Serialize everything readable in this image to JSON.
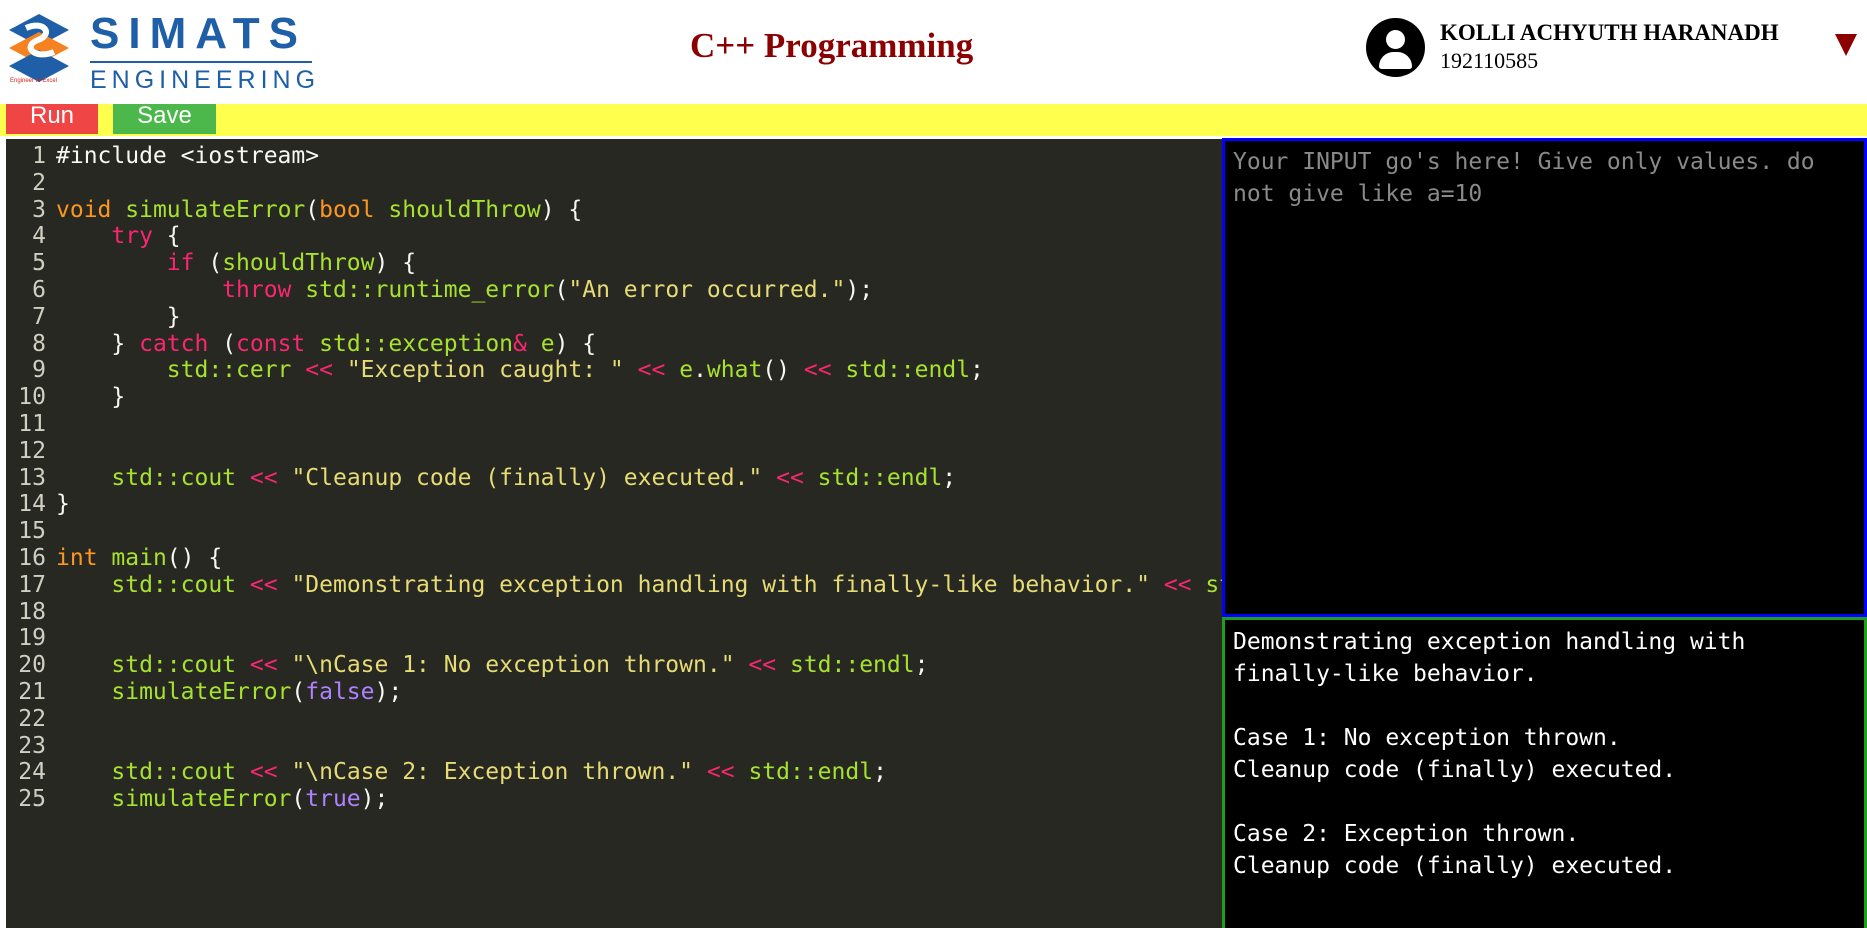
{
  "header": {
    "brand_name": "SIMATS",
    "brand_sub": "ENGINEERING",
    "brand_tagline": "Engineer to Excel",
    "course_title": "C++ Programming",
    "user_name": "KOLLI ACHYUTH HARANADH",
    "user_id": "192110585"
  },
  "toolbar": {
    "run_label": "Run",
    "save_label": "Save"
  },
  "editor": {
    "lines": [
      {
        "n": "1",
        "t": [
          [
            "pp",
            "#include <iostream>"
          ]
        ]
      },
      {
        "n": "2",
        "t": []
      },
      {
        "n": "3",
        "t": [
          [
            "type",
            "void"
          ],
          [
            "p",
            " "
          ],
          [
            "fn",
            "simulateError"
          ],
          [
            "p",
            "("
          ],
          [
            "type",
            "bool"
          ],
          [
            "p",
            " "
          ],
          [
            "id",
            "shouldThrow"
          ],
          [
            "p",
            ") {"
          ]
        ]
      },
      {
        "n": "4",
        "t": [
          [
            "p",
            "    "
          ],
          [
            "kw",
            "try"
          ],
          [
            "p",
            " {"
          ]
        ]
      },
      {
        "n": "5",
        "t": [
          [
            "p",
            "        "
          ],
          [
            "kw",
            "if"
          ],
          [
            "p",
            " ("
          ],
          [
            "id",
            "shouldThrow"
          ],
          [
            "p",
            ") {"
          ]
        ]
      },
      {
        "n": "6",
        "t": [
          [
            "p",
            "            "
          ],
          [
            "kw",
            "throw"
          ],
          [
            "p",
            " "
          ],
          [
            "fn",
            "std::runtime_error"
          ],
          [
            "p",
            "("
          ],
          [
            "str",
            "\"An error occurred.\""
          ],
          [
            "p",
            ");"
          ]
        ]
      },
      {
        "n": "7",
        "t": [
          [
            "p",
            "        }"
          ]
        ]
      },
      {
        "n": "8",
        "t": [
          [
            "p",
            "    } "
          ],
          [
            "kw",
            "catch"
          ],
          [
            "p",
            " ("
          ],
          [
            "kw",
            "const"
          ],
          [
            "p",
            " "
          ],
          [
            "id",
            "std::exception"
          ],
          [
            "op",
            "&"
          ],
          [
            "p",
            " "
          ],
          [
            "id",
            "e"
          ],
          [
            "p",
            ") {"
          ]
        ]
      },
      {
        "n": "9",
        "t": [
          [
            "p",
            "        "
          ],
          [
            "id",
            "std::cerr"
          ],
          [
            "p",
            " "
          ],
          [
            "op",
            "<<"
          ],
          [
            "p",
            " "
          ],
          [
            "str",
            "\"Exception caught: \""
          ],
          [
            "p",
            " "
          ],
          [
            "op",
            "<<"
          ],
          [
            "p",
            " "
          ],
          [
            "id",
            "e"
          ],
          [
            "p",
            "."
          ],
          [
            "fn",
            "what"
          ],
          [
            "p",
            "() "
          ],
          [
            "op",
            "<<"
          ],
          [
            "p",
            " "
          ],
          [
            "id",
            "std::endl"
          ],
          [
            "p",
            ";"
          ]
        ]
      },
      {
        "n": "10",
        "t": [
          [
            "p",
            "    }"
          ]
        ]
      },
      {
        "n": "11",
        "t": []
      },
      {
        "n": "12",
        "t": []
      },
      {
        "n": "13",
        "t": [
          [
            "p",
            "    "
          ],
          [
            "id",
            "std::cout"
          ],
          [
            "p",
            " "
          ],
          [
            "op",
            "<<"
          ],
          [
            "p",
            " "
          ],
          [
            "str",
            "\"Cleanup code (finally) executed.\""
          ],
          [
            "p",
            " "
          ],
          [
            "op",
            "<<"
          ],
          [
            "p",
            " "
          ],
          [
            "id",
            "std::endl"
          ],
          [
            "p",
            ";"
          ]
        ]
      },
      {
        "n": "14",
        "t": [
          [
            "p",
            "}"
          ]
        ]
      },
      {
        "n": "15",
        "t": []
      },
      {
        "n": "16",
        "t": [
          [
            "type",
            "int"
          ],
          [
            "p",
            " "
          ],
          [
            "fn",
            "main"
          ],
          [
            "p",
            "() {"
          ]
        ]
      },
      {
        "n": "17",
        "t": [
          [
            "p",
            "    "
          ],
          [
            "id",
            "std::cout"
          ],
          [
            "p",
            " "
          ],
          [
            "op",
            "<<"
          ],
          [
            "p",
            " "
          ],
          [
            "str",
            "\"Demonstrating exception handling with finally-like behavior.\""
          ],
          [
            "p",
            " "
          ],
          [
            "op",
            "<<"
          ],
          [
            "p",
            " "
          ],
          [
            "id",
            "std::endl"
          ],
          [
            "p",
            ";"
          ]
        ]
      },
      {
        "n": "18",
        "t": []
      },
      {
        "n": "19",
        "t": []
      },
      {
        "n": "20",
        "t": [
          [
            "p",
            "    "
          ],
          [
            "id",
            "std::cout"
          ],
          [
            "p",
            " "
          ],
          [
            "op",
            "<<"
          ],
          [
            "p",
            " "
          ],
          [
            "str",
            "\"\\nCase 1: No exception thrown.\""
          ],
          [
            "p",
            " "
          ],
          [
            "op",
            "<<"
          ],
          [
            "p",
            " "
          ],
          [
            "id",
            "std::endl"
          ],
          [
            "p",
            ";"
          ]
        ]
      },
      {
        "n": "21",
        "t": [
          [
            "p",
            "    "
          ],
          [
            "fn",
            "simulateError"
          ],
          [
            "p",
            "("
          ],
          [
            "const",
            "false"
          ],
          [
            "p",
            ");"
          ]
        ]
      },
      {
        "n": "22",
        "t": []
      },
      {
        "n": "23",
        "t": []
      },
      {
        "n": "24",
        "t": [
          [
            "p",
            "    "
          ],
          [
            "id",
            "std::cout"
          ],
          [
            "p",
            " "
          ],
          [
            "op",
            "<<"
          ],
          [
            "p",
            " "
          ],
          [
            "str",
            "\"\\nCase 2: Exception thrown.\""
          ],
          [
            "p",
            " "
          ],
          [
            "op",
            "<<"
          ],
          [
            "p",
            " "
          ],
          [
            "id",
            "std::endl"
          ],
          [
            "p",
            ";"
          ]
        ]
      },
      {
        "n": "25",
        "t": [
          [
            "p",
            "    "
          ],
          [
            "fn",
            "simulateError"
          ],
          [
            "p",
            "("
          ],
          [
            "const",
            "true"
          ],
          [
            "p",
            ");"
          ]
        ]
      }
    ]
  },
  "input": {
    "placeholder": "Your INPUT go's here! Give only values. do not give like a=10",
    "value": ""
  },
  "output": {
    "lines": [
      "Demonstrating exception handling with",
      "finally-like behavior.",
      "",
      "Case 1: No exception thrown.",
      "Cleanup code (finally) executed.",
      "",
      "Case 2: Exception thrown.",
      "Cleanup code (finally) executed."
    ]
  }
}
